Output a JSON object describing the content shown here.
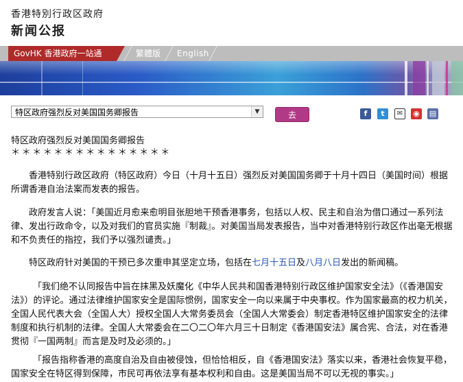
{
  "header": {
    "gov_name": "香港特別行政区政府",
    "section_title": "新闻公报"
  },
  "nav": {
    "govhk_label": "GovHK 香港政府一站通",
    "traditional_label": "繁體版",
    "english_label": "English"
  },
  "toolbar": {
    "select_value": "特区政府强烈反对美国国务卿报告",
    "go_label": "去",
    "share_icons": [
      "facebook-icon",
      "twitter-icon",
      "email-icon",
      "weibo-icon",
      "print-icon"
    ]
  },
  "article": {
    "title": "特区政府强烈反对美国国务卿报告",
    "stars": "＊＊＊＊＊＊＊＊＊＊＊＊＊＊＊",
    "p1": "香港特别行政区政府（特区政府）今日（十月十五日）强烈反对美国国务卿于十月十四日（美国时间）根据所谓香港自治法案而发表的报告。",
    "p2": "政府发言人说：「美国近月愈来愈明目张胆地干预香港事务，包括以人权、民主和自治为借口通过一系列法律、发出行政命令，以及对我们的官员实施『制裁』。对美国当局发表报告，当中对香港特别行政区作出毫无根据和不负责任的指控，我们予以强烈谴责。」",
    "p3_a": "特区政府针对美国的干预已多次重申其坚定立场，包括在",
    "p3_link1": "七月十五日",
    "p3_mid": "及",
    "p3_link2": "八月八日",
    "p3_b": "发出的新闻稿。",
    "p4": "「我们绝不认同报告中旨在抹黑及妖魔化《中华人民共和国香港特别行政区维护国家安全法》（《香港国安法》）的评论。通过法律维护国家安全是国际惯例，国家安全一向以来属于中央事权。作为国家最高的权力机关，全国人民代表大会（全国人大）授权全国人大常务委员会（全国人大常委会）制定香港特区维护国家安全的法律制度和执行机制的法律。全国人大常委会在二〇二〇年六月三十日制定《香港国安法》属合宪、合法，对在香港贯彻『一国两制』而言是及时及必须的。」",
    "p5": "「报告指称香港的高度自治及自由被侵蚀，但恰恰相反，自《香港国安法》落实以来，香港社会恢复平稳，国家安全在特区得到保障，市民可再依法享有基本权利和自由。这是美国当局不可以无视的事实。」"
  },
  "colors": {
    "govhk_tab": "#b02a2a",
    "go_button": "#b13a86",
    "link": "#2a57b8"
  }
}
